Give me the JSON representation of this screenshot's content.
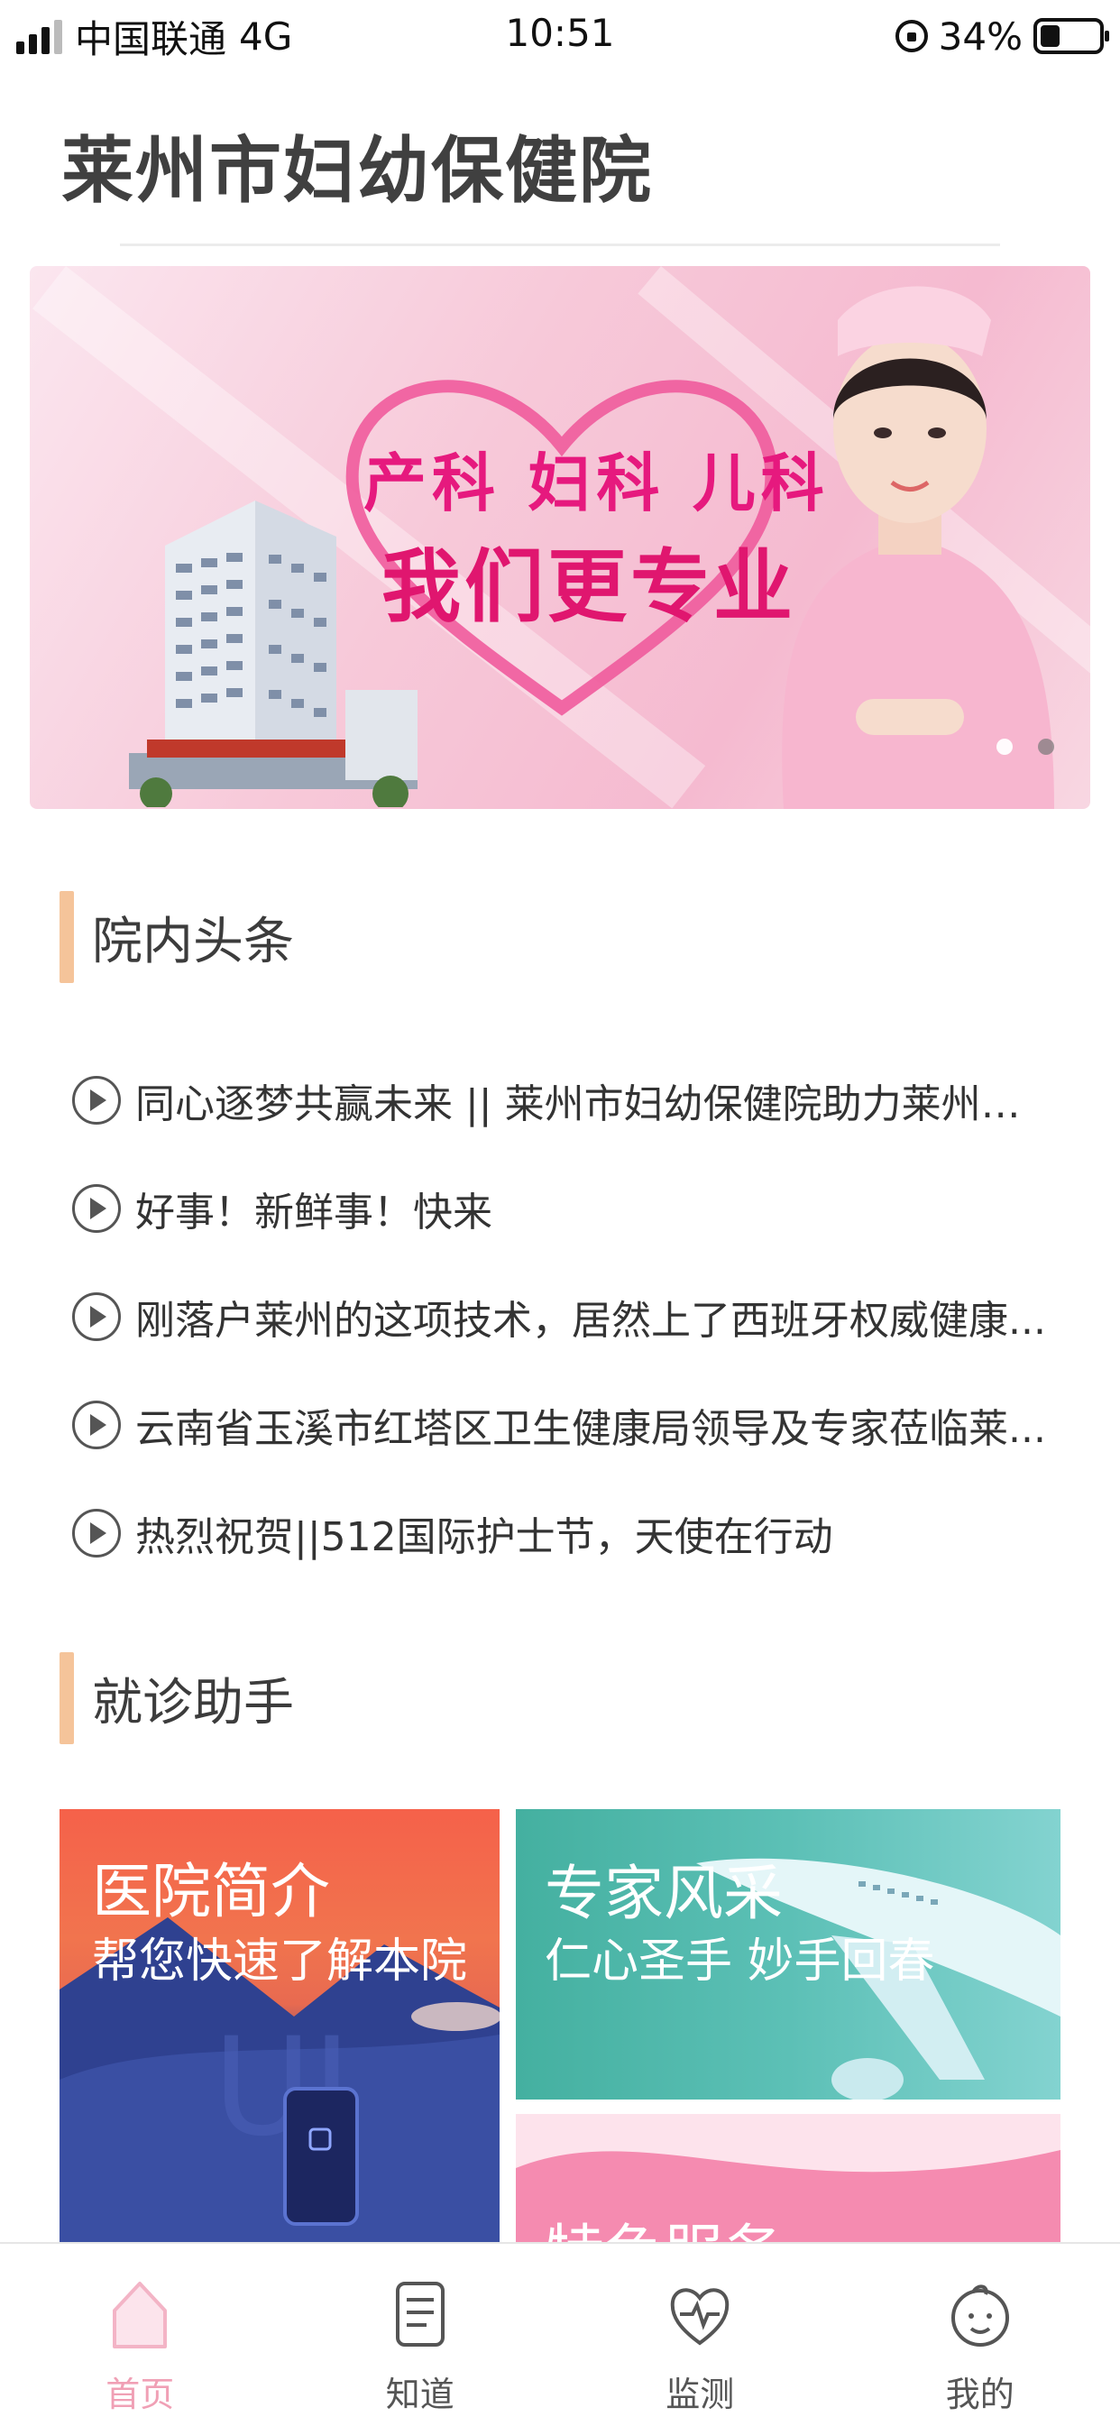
{
  "status_bar": {
    "carrier": "中国联通",
    "network": "4G",
    "time": "10:51",
    "battery": "34%",
    "battery_level": 0.34
  },
  "header": {
    "title": "莱州市妇幼保健院"
  },
  "banner": {
    "line1": "产科  妇科  儿科",
    "line2": "我们更专业",
    "slide_count": 2,
    "active_slide": 1
  },
  "news_section": {
    "title": "院内头条",
    "items": [
      {
        "title": "同心逐梦共赢未来 || 莱州市妇幼保健院助力莱州首..."
      },
      {
        "title": "好事！新鲜事！快来"
      },
      {
        "title": "刚落户莱州的这项技术，居然上了西班牙权威健康..."
      },
      {
        "title": "云南省玉溪市红塔区卫生健康局领导及专家莅临莱..."
      },
      {
        "title": "热烈祝贺||512国际护士节，天使在行动"
      }
    ]
  },
  "assistant_section": {
    "title": "就诊助手",
    "cards": {
      "intro": {
        "title": "医院简介",
        "subtitle": "帮您快速了解本院"
      },
      "experts": {
        "title": "专家风采",
        "subtitle": "仁心圣手  妙手回春"
      },
      "services": {
        "title": "特色服务"
      }
    }
  },
  "tab_bar": {
    "items": [
      {
        "label": "首页",
        "icon": "home-icon",
        "active": true
      },
      {
        "label": "知道",
        "icon": "document-icon",
        "active": false
      },
      {
        "label": "监测",
        "icon": "heart-monitor-icon",
        "active": false
      },
      {
        "label": "我的",
        "icon": "baby-face-icon",
        "active": false
      }
    ],
    "active_color": "#f0a0b5"
  },
  "colors": {
    "accent_bar": "#f5c49a",
    "banner_pink": "#e6197e"
  }
}
